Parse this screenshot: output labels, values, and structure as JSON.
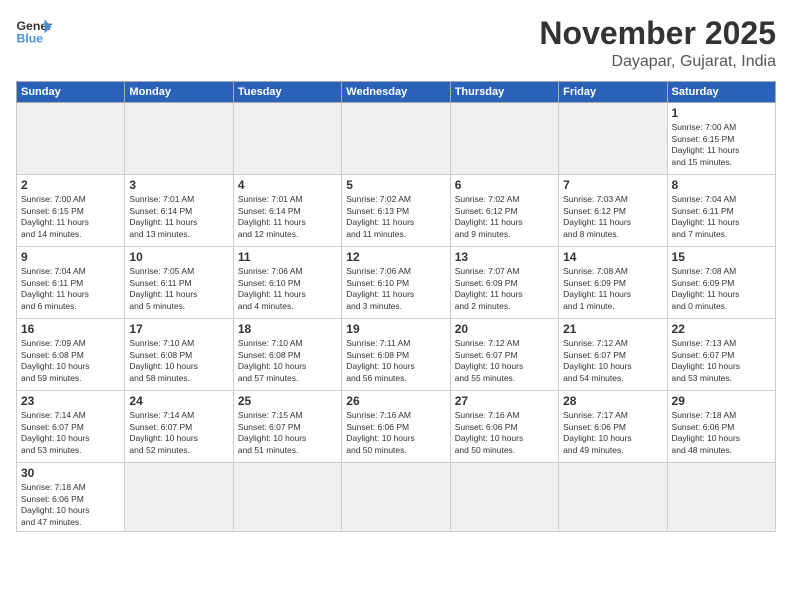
{
  "header": {
    "logo_general": "General",
    "logo_blue": "Blue",
    "month": "November 2025",
    "location": "Dayapar, Gujarat, India"
  },
  "weekdays": [
    "Sunday",
    "Monday",
    "Tuesday",
    "Wednesday",
    "Thursday",
    "Friday",
    "Saturday"
  ],
  "weeks": [
    [
      {
        "day": "",
        "info": ""
      },
      {
        "day": "",
        "info": ""
      },
      {
        "day": "",
        "info": ""
      },
      {
        "day": "",
        "info": ""
      },
      {
        "day": "",
        "info": ""
      },
      {
        "day": "",
        "info": ""
      },
      {
        "day": "1",
        "info": "Sunrise: 7:00 AM\nSunset: 6:15 PM\nDaylight: 11 hours\nand 15 minutes."
      }
    ],
    [
      {
        "day": "2",
        "info": "Sunrise: 7:00 AM\nSunset: 6:15 PM\nDaylight: 11 hours\nand 14 minutes."
      },
      {
        "day": "3",
        "info": "Sunrise: 7:01 AM\nSunset: 6:14 PM\nDaylight: 11 hours\nand 13 minutes."
      },
      {
        "day": "4",
        "info": "Sunrise: 7:01 AM\nSunset: 6:14 PM\nDaylight: 11 hours\nand 12 minutes."
      },
      {
        "day": "5",
        "info": "Sunrise: 7:02 AM\nSunset: 6:13 PM\nDaylight: 11 hours\nand 11 minutes."
      },
      {
        "day": "6",
        "info": "Sunrise: 7:02 AM\nSunset: 6:12 PM\nDaylight: 11 hours\nand 9 minutes."
      },
      {
        "day": "7",
        "info": "Sunrise: 7:03 AM\nSunset: 6:12 PM\nDaylight: 11 hours\nand 8 minutes."
      },
      {
        "day": "8",
        "info": "Sunrise: 7:04 AM\nSunset: 6:11 PM\nDaylight: 11 hours\nand 7 minutes."
      }
    ],
    [
      {
        "day": "9",
        "info": "Sunrise: 7:04 AM\nSunset: 6:11 PM\nDaylight: 11 hours\nand 6 minutes."
      },
      {
        "day": "10",
        "info": "Sunrise: 7:05 AM\nSunset: 6:11 PM\nDaylight: 11 hours\nand 5 minutes."
      },
      {
        "day": "11",
        "info": "Sunrise: 7:06 AM\nSunset: 6:10 PM\nDaylight: 11 hours\nand 4 minutes."
      },
      {
        "day": "12",
        "info": "Sunrise: 7:06 AM\nSunset: 6:10 PM\nDaylight: 11 hours\nand 3 minutes."
      },
      {
        "day": "13",
        "info": "Sunrise: 7:07 AM\nSunset: 6:09 PM\nDaylight: 11 hours\nand 2 minutes."
      },
      {
        "day": "14",
        "info": "Sunrise: 7:08 AM\nSunset: 6:09 PM\nDaylight: 11 hours\nand 1 minute."
      },
      {
        "day": "15",
        "info": "Sunrise: 7:08 AM\nSunset: 6:09 PM\nDaylight: 11 hours\nand 0 minutes."
      }
    ],
    [
      {
        "day": "16",
        "info": "Sunrise: 7:09 AM\nSunset: 6:08 PM\nDaylight: 10 hours\nand 59 minutes."
      },
      {
        "day": "17",
        "info": "Sunrise: 7:10 AM\nSunset: 6:08 PM\nDaylight: 10 hours\nand 58 minutes."
      },
      {
        "day": "18",
        "info": "Sunrise: 7:10 AM\nSunset: 6:08 PM\nDaylight: 10 hours\nand 57 minutes."
      },
      {
        "day": "19",
        "info": "Sunrise: 7:11 AM\nSunset: 6:08 PM\nDaylight: 10 hours\nand 56 minutes."
      },
      {
        "day": "20",
        "info": "Sunrise: 7:12 AM\nSunset: 6:07 PM\nDaylight: 10 hours\nand 55 minutes."
      },
      {
        "day": "21",
        "info": "Sunrise: 7:12 AM\nSunset: 6:07 PM\nDaylight: 10 hours\nand 54 minutes."
      },
      {
        "day": "22",
        "info": "Sunrise: 7:13 AM\nSunset: 6:07 PM\nDaylight: 10 hours\nand 53 minutes."
      }
    ],
    [
      {
        "day": "23",
        "info": "Sunrise: 7:14 AM\nSunset: 6:07 PM\nDaylight: 10 hours\nand 53 minutes."
      },
      {
        "day": "24",
        "info": "Sunrise: 7:14 AM\nSunset: 6:07 PM\nDaylight: 10 hours\nand 52 minutes."
      },
      {
        "day": "25",
        "info": "Sunrise: 7:15 AM\nSunset: 6:07 PM\nDaylight: 10 hours\nand 51 minutes."
      },
      {
        "day": "26",
        "info": "Sunrise: 7:16 AM\nSunset: 6:06 PM\nDaylight: 10 hours\nand 50 minutes."
      },
      {
        "day": "27",
        "info": "Sunrise: 7:16 AM\nSunset: 6:06 PM\nDaylight: 10 hours\nand 50 minutes."
      },
      {
        "day": "28",
        "info": "Sunrise: 7:17 AM\nSunset: 6:06 PM\nDaylight: 10 hours\nand 49 minutes."
      },
      {
        "day": "29",
        "info": "Sunrise: 7:18 AM\nSunset: 6:06 PM\nDaylight: 10 hours\nand 48 minutes."
      }
    ],
    [
      {
        "day": "30",
        "info": "Sunrise: 7:18 AM\nSunset: 6:06 PM\nDaylight: 10 hours\nand 47 minutes."
      },
      {
        "day": "",
        "info": ""
      },
      {
        "day": "",
        "info": ""
      },
      {
        "day": "",
        "info": ""
      },
      {
        "day": "",
        "info": ""
      },
      {
        "day": "",
        "info": ""
      },
      {
        "day": "",
        "info": ""
      }
    ]
  ]
}
